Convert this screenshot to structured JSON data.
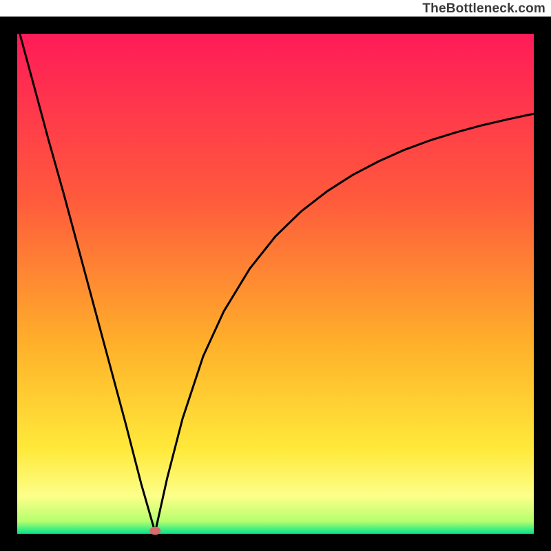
{
  "attribution": "TheBottleneck.com",
  "chart_data": {
    "type": "line",
    "title": "",
    "xlabel": "",
    "ylabel": "",
    "xlim": [
      0,
      100
    ],
    "ylim": [
      0,
      100
    ],
    "grid": false,
    "legend": {
      "visible": false
    },
    "annotations": [],
    "curve_note": "V-shaped bottleneck curve; minimum (~0) near x≈26.7; left branch near-linear to 100 at x→0; right branch rises concavely toward ≈84 at x=100.",
    "series": [
      {
        "name": "bottleneck-curve",
        "x": [
          0.5,
          3,
          6,
          9,
          12,
          15,
          18,
          21,
          24,
          26.7,
          29,
          32,
          36,
          40,
          45,
          50,
          55,
          60,
          65,
          70,
          75,
          80,
          85,
          90,
          95,
          100
        ],
        "values": [
          100,
          90.5,
          79,
          68,
          56.5,
          45,
          33.5,
          22,
          10,
          0.3,
          11,
          23,
          35.5,
          44.5,
          53,
          59.5,
          64.5,
          68.5,
          71.8,
          74.5,
          76.8,
          78.7,
          80.3,
          81.7,
          82.9,
          84
        ]
      }
    ],
    "marker": {
      "x": 26.7,
      "y": 0.6,
      "color": "#d86b6b"
    },
    "gradient_bands": [
      {
        "start": "#ff1b58",
        "end": "#ff5a3c",
        "from_y": 100,
        "to_y": 67
      },
      {
        "start": "#ff5a3c",
        "end": "#ffb02a",
        "from_y": 67,
        "to_y": 38
      },
      {
        "start": "#ffb02a",
        "end": "#ffe93a",
        "from_y": 38,
        "to_y": 17
      },
      {
        "start": "#ffe93a",
        "end": "#fdff8a",
        "from_y": 17,
        "to_y": 7.5
      },
      {
        "start": "#fdff8a",
        "end": "#b6ff6e",
        "from_y": 7.5,
        "to_y": 2.5
      },
      {
        "start": "#b6ff6e",
        "end": "#00e58a",
        "from_y": 2.5,
        "to_y": 0
      }
    ],
    "frame": {
      "color": "#000000",
      "thickness_px": 25
    }
  }
}
